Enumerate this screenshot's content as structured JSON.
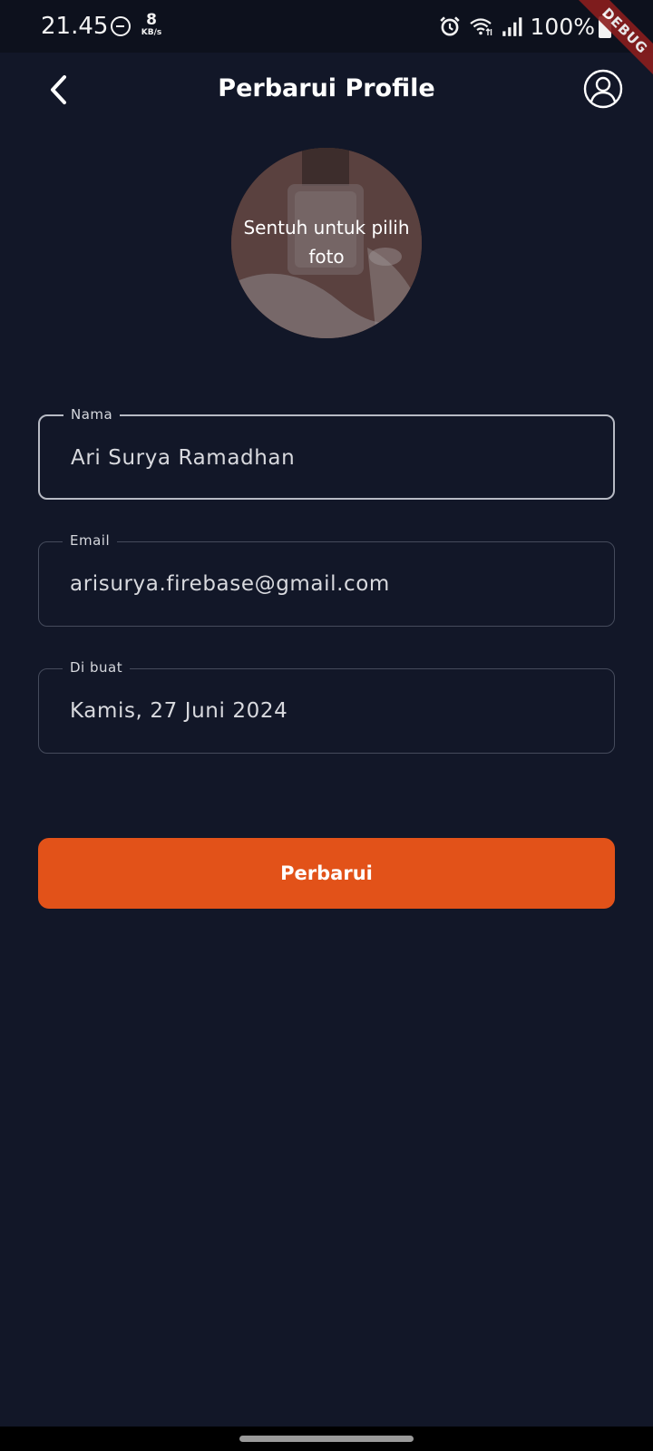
{
  "status_bar": {
    "time": "21.45",
    "speed_value": "8",
    "speed_unit": "KB/s",
    "battery_percent": "100%",
    "icons": [
      "do-not-disturb-icon",
      "alarm-icon",
      "wifi-icon",
      "signal-icon",
      "battery-icon"
    ]
  },
  "debug_banner": "DEBUG",
  "app_bar": {
    "title": "Perbarui Profile",
    "back_icon": "chevron-left-icon",
    "profile_icon": "user-circle-icon"
  },
  "avatar": {
    "hint": "Sentuh untuk pilih foto"
  },
  "form": {
    "fields": [
      {
        "label": "Nama",
        "value": "Ari Surya Ramadhan"
      },
      {
        "label": "Email",
        "value": "arisurya.firebase@gmail.com"
      },
      {
        "label": "Di buat",
        "value": "Kamis, 27 Juni 2024"
      }
    ]
  },
  "submit_label": "Perbarui",
  "colors": {
    "background": "#121728",
    "accent": "#e25219",
    "field_border": "#454b5c",
    "field_border_active": "#b7bac4"
  }
}
